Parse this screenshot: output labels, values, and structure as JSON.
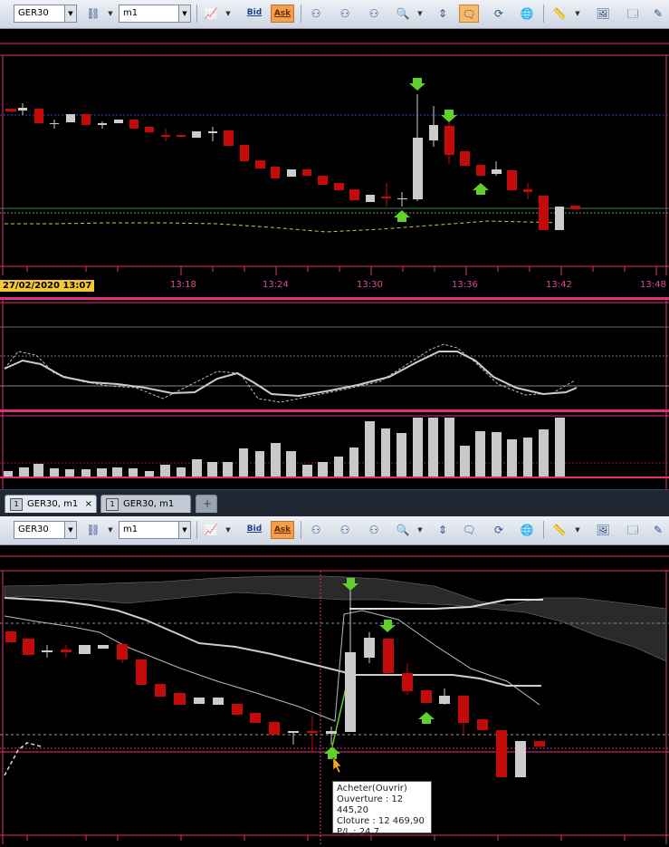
{
  "toolbar_top": {
    "symbol": "GER30",
    "timeframe": "m1",
    "bid_label": "Bid",
    "ask_label": "Ask"
  },
  "toolbar_bottom": {
    "symbol": "GER30",
    "timeframe": "m1",
    "bid_label": "Bid",
    "ask_label": "Ask"
  },
  "time_axis": {
    "cursor_label": "27/02/2020 13:07",
    "labels": [
      "13:18",
      "13:24",
      "13:30",
      "13:36",
      "13:42",
      "13:48"
    ]
  },
  "tabs": [
    {
      "label": "GER30, m1",
      "close": "×",
      "active": true
    },
    {
      "label": "GER30, m1",
      "active": false
    },
    {
      "label": "+"
    }
  ],
  "tooltip": {
    "title": "Acheter(Ouvrir)",
    "open": "Ouverture : 12 445,20",
    "close": "Cloture : 12 469,90",
    "pl": "P/L : 24,7"
  },
  "colors": {
    "bull": "#c8c8c8",
    "bear": "#c20a0a",
    "accent_pink": "#e0307a",
    "arrow_green": "#5fd12a",
    "cursor_bg": "#f5c832"
  }
}
